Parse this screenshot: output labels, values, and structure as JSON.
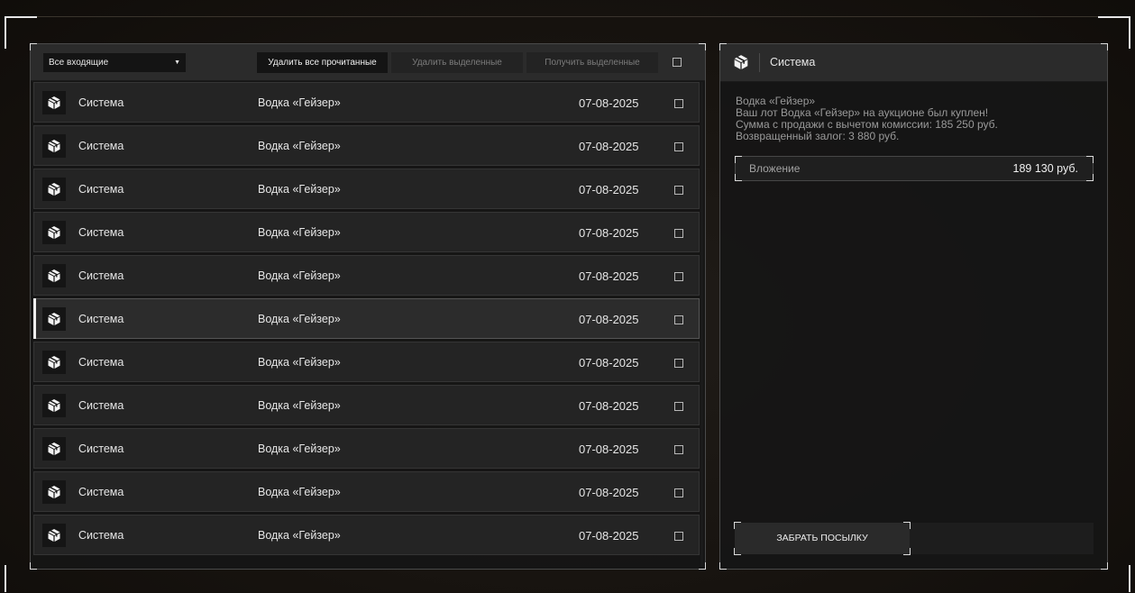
{
  "toolbar": {
    "filter_value": "Все входящие",
    "delete_read_label": "Удалить все прочитанные",
    "delete_selected_label": "Удалить выделенные",
    "get_selected_label": "Получить выделенные"
  },
  "messages": [
    {
      "sender": "Система",
      "subject": "Водка «Гейзер»",
      "date": "07-08-2025"
    },
    {
      "sender": "Система",
      "subject": "Водка «Гейзер»",
      "date": "07-08-2025"
    },
    {
      "sender": "Система",
      "subject": "Водка «Гейзер»",
      "date": "07-08-2025"
    },
    {
      "sender": "Система",
      "subject": "Водка «Гейзер»",
      "date": "07-08-2025"
    },
    {
      "sender": "Система",
      "subject": "Водка «Гейзер»",
      "date": "07-08-2025"
    },
    {
      "sender": "Система",
      "subject": "Водка «Гейзер»",
      "date": "07-08-2025"
    },
    {
      "sender": "Система",
      "subject": "Водка «Гейзер»",
      "date": "07-08-2025"
    },
    {
      "sender": "Система",
      "subject": "Водка «Гейзер»",
      "date": "07-08-2025"
    },
    {
      "sender": "Система",
      "subject": "Водка «Гейзер»",
      "date": "07-08-2025"
    },
    {
      "sender": "Система",
      "subject": "Водка «Гейзер»",
      "date": "07-08-2025"
    },
    {
      "sender": "Система",
      "subject": "Водка «Гейзер»",
      "date": "07-08-2025"
    }
  ],
  "selected_message_index": 5,
  "detail": {
    "sender": "Система",
    "body_lines": [
      "Водка «Гейзер»",
      "Ваш лот Водка «Гейзер» на аукционе был куплен!",
      "Сумма с продажи с вычетом комиссии: 185 250 руб.",
      "Возвращенный залог: 3 880 руб."
    ],
    "attachment_label": "Вложение",
    "attachment_value": "189 130 руб.",
    "collect_label": "ЗАБРАТЬ ПОСЫЛКУ"
  },
  "icons": {
    "row_icon": "package-icon",
    "header_icon": "package-icon"
  },
  "colors": {
    "accent": "#f0f0f0",
    "panel_bg": "#161616",
    "row_bg": "#242424"
  }
}
